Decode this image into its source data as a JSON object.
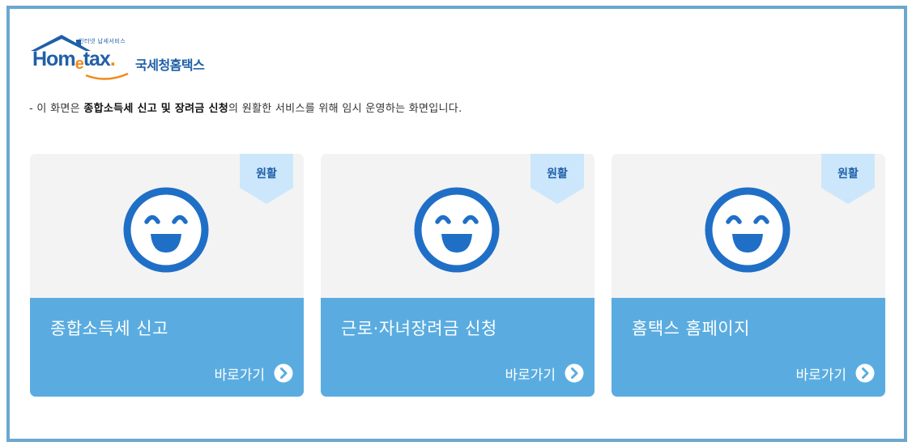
{
  "logo": {
    "tagline": "인터넷 납세서비스",
    "word_pre": "Hom",
    "word_e": "e",
    "word_post": "tax",
    "word_dot": ".",
    "korean": "국세청홈택스",
    "colors": {
      "brand_blue": "#1f5fa8",
      "accent_orange": "#f08a1c"
    }
  },
  "notice": {
    "prefix": "- 이 화면은 ",
    "bold": "종합소득세 신고 및 장려금 신청",
    "suffix": "의 원활한 서비스를 위해 임시 운영하는 화면입니다."
  },
  "cards": [
    {
      "status": "원활",
      "title": "종합소득세 신고",
      "link_label": "바로가기",
      "icon": "smiley-face-icon"
    },
    {
      "status": "원활",
      "title": "근로·자녀장려금 신청",
      "link_label": "바로가기",
      "icon": "smiley-face-icon"
    },
    {
      "status": "원활",
      "title": "홈택스 홈페이지",
      "link_label": "바로가기",
      "icon": "smiley-face-icon"
    }
  ],
  "colors": {
    "frame_border": "#6aa8d0",
    "card_top": "#f3f3f3",
    "card_bottom": "#5aace0",
    "badge_bg": "#cce7fb",
    "face_blue": "#1f6fc7"
  }
}
